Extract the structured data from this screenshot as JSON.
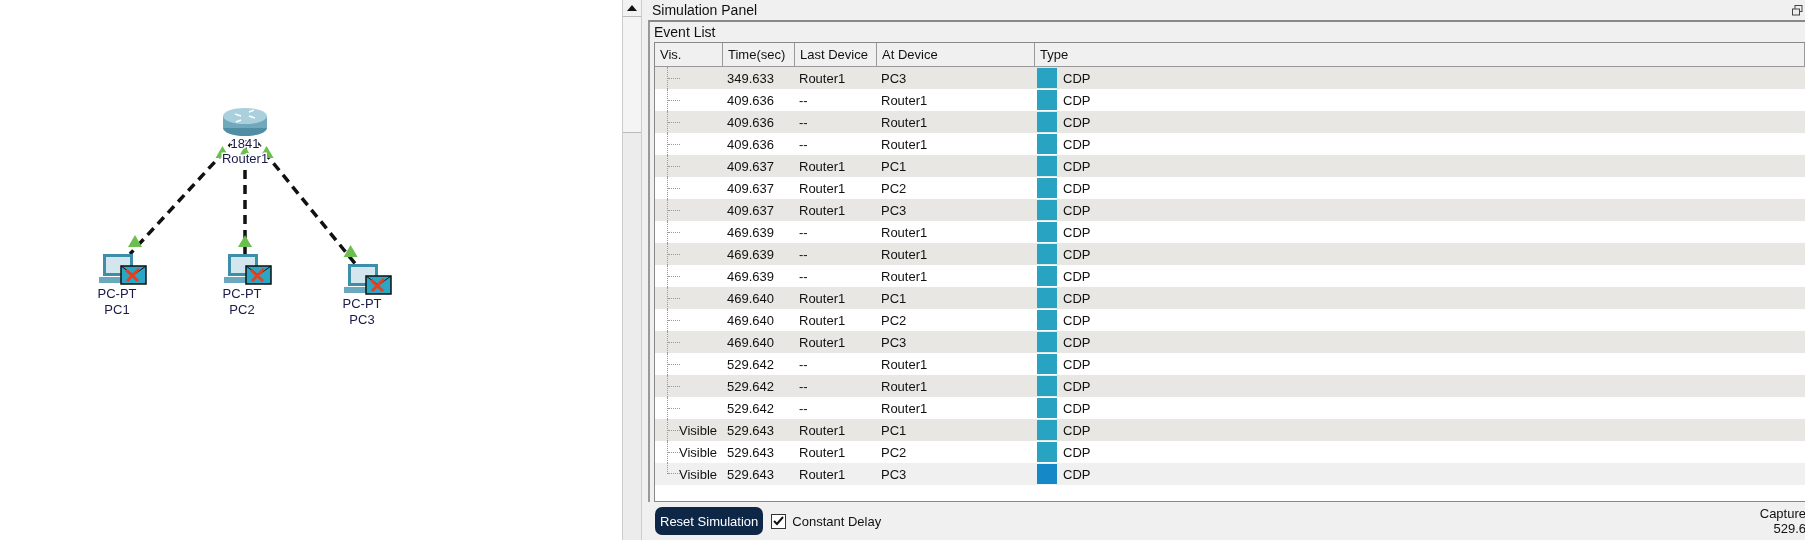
{
  "topology": {
    "router": {
      "model": "1841",
      "name": "Router1"
    },
    "pcs": [
      {
        "model": "PC-PT",
        "name": "PC1"
      },
      {
        "model": "PC-PT",
        "name": "PC2"
      },
      {
        "model": "PC-PT",
        "name": "PC3"
      }
    ]
  },
  "panel": {
    "title": "Simulation Panel",
    "event_list": {
      "title": "Event List",
      "columns": [
        "Vis.",
        "Time(sec)",
        "Last Device",
        "At Device",
        "Type"
      ],
      "rows": [
        {
          "time": "349.633",
          "last_device": "Router1",
          "at_device": "PC3",
          "type": "CDP",
          "selected": false
        },
        {
          "time": "409.636",
          "last_device": "--",
          "at_device": "Router1",
          "type": "CDP",
          "selected": false
        },
        {
          "time": "409.636",
          "last_device": "--",
          "at_device": "Router1",
          "type": "CDP",
          "selected": false
        },
        {
          "time": "409.636",
          "last_device": "--",
          "at_device": "Router1",
          "type": "CDP",
          "selected": false
        },
        {
          "time": "409.637",
          "last_device": "Router1",
          "at_device": "PC1",
          "type": "CDP",
          "selected": false
        },
        {
          "time": "409.637",
          "last_device": "Router1",
          "at_device": "PC2",
          "type": "CDP",
          "selected": false
        },
        {
          "time": "409.637",
          "last_device": "Router1",
          "at_device": "PC3",
          "type": "CDP",
          "selected": false
        },
        {
          "time": "469.639",
          "last_device": "--",
          "at_device": "Router1",
          "type": "CDP",
          "selected": false
        },
        {
          "time": "469.639",
          "last_device": "--",
          "at_device": "Router1",
          "type": "CDP",
          "selected": false
        },
        {
          "time": "469.639",
          "last_device": "--",
          "at_device": "Router1",
          "type": "CDP",
          "selected": false
        },
        {
          "time": "469.640",
          "last_device": "Router1",
          "at_device": "PC1",
          "type": "CDP",
          "selected": false
        },
        {
          "time": "469.640",
          "last_device": "Router1",
          "at_device": "PC2",
          "type": "CDP",
          "selected": false
        },
        {
          "time": "469.640",
          "last_device": "Router1",
          "at_device": "PC3",
          "type": "CDP",
          "selected": false
        },
        {
          "time": "529.642",
          "last_device": "--",
          "at_device": "Router1",
          "type": "CDP",
          "selected": false
        },
        {
          "time": "529.642",
          "last_device": "--",
          "at_device": "Router1",
          "type": "CDP",
          "selected": false
        },
        {
          "time": "529.642",
          "last_device": "--",
          "at_device": "Router1",
          "type": "CDP",
          "selected": false
        },
        {
          "vis": "Visible",
          "time": "529.643",
          "last_device": "Router1",
          "at_device": "PC1",
          "type": "CDP",
          "selected": false
        },
        {
          "vis": "Visible",
          "time": "529.643",
          "last_device": "Router1",
          "at_device": "PC2",
          "type": "CDP",
          "selected": false
        },
        {
          "vis": "Visible",
          "time": "529.643",
          "last_device": "Router1",
          "at_device": "PC3",
          "type": "CDP",
          "selected": true
        }
      ]
    },
    "reset_button": "Reset Simulation",
    "constant_delay": {
      "label": "Constant Delay",
      "checked": true
    },
    "captured": {
      "label": "Capture",
      "time": "529.6"
    }
  }
}
